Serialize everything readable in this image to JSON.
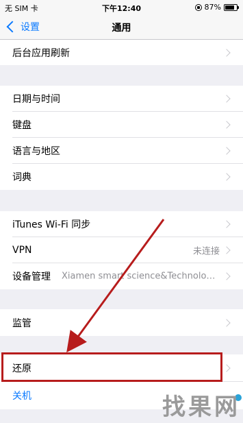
{
  "status_bar": {
    "carrier": "无 SIM 卡",
    "time": "下午12:40",
    "battery": "87%"
  },
  "nav": {
    "back_label": "设置",
    "title": "通用"
  },
  "rows": {
    "background_refresh": "后台应用刷新",
    "date_time": "日期与时间",
    "keyboard": "键盘",
    "language_region": "语言与地区",
    "dictionary": "词典",
    "itunes_wifi_sync": "iTunes Wi-Fi 同步",
    "vpn": "VPN",
    "vpn_status": "未连接",
    "device_management": "设备管理",
    "device_management_value": "Xiamen smart science&Technolog...",
    "restrictions": "监管",
    "reset": "还原",
    "shutdown": "关机"
  },
  "watermark": "找果网",
  "colors": {
    "accent_blue": "#0a7aff",
    "annotation_red": "#b71c1c",
    "background": "#efeff4"
  }
}
